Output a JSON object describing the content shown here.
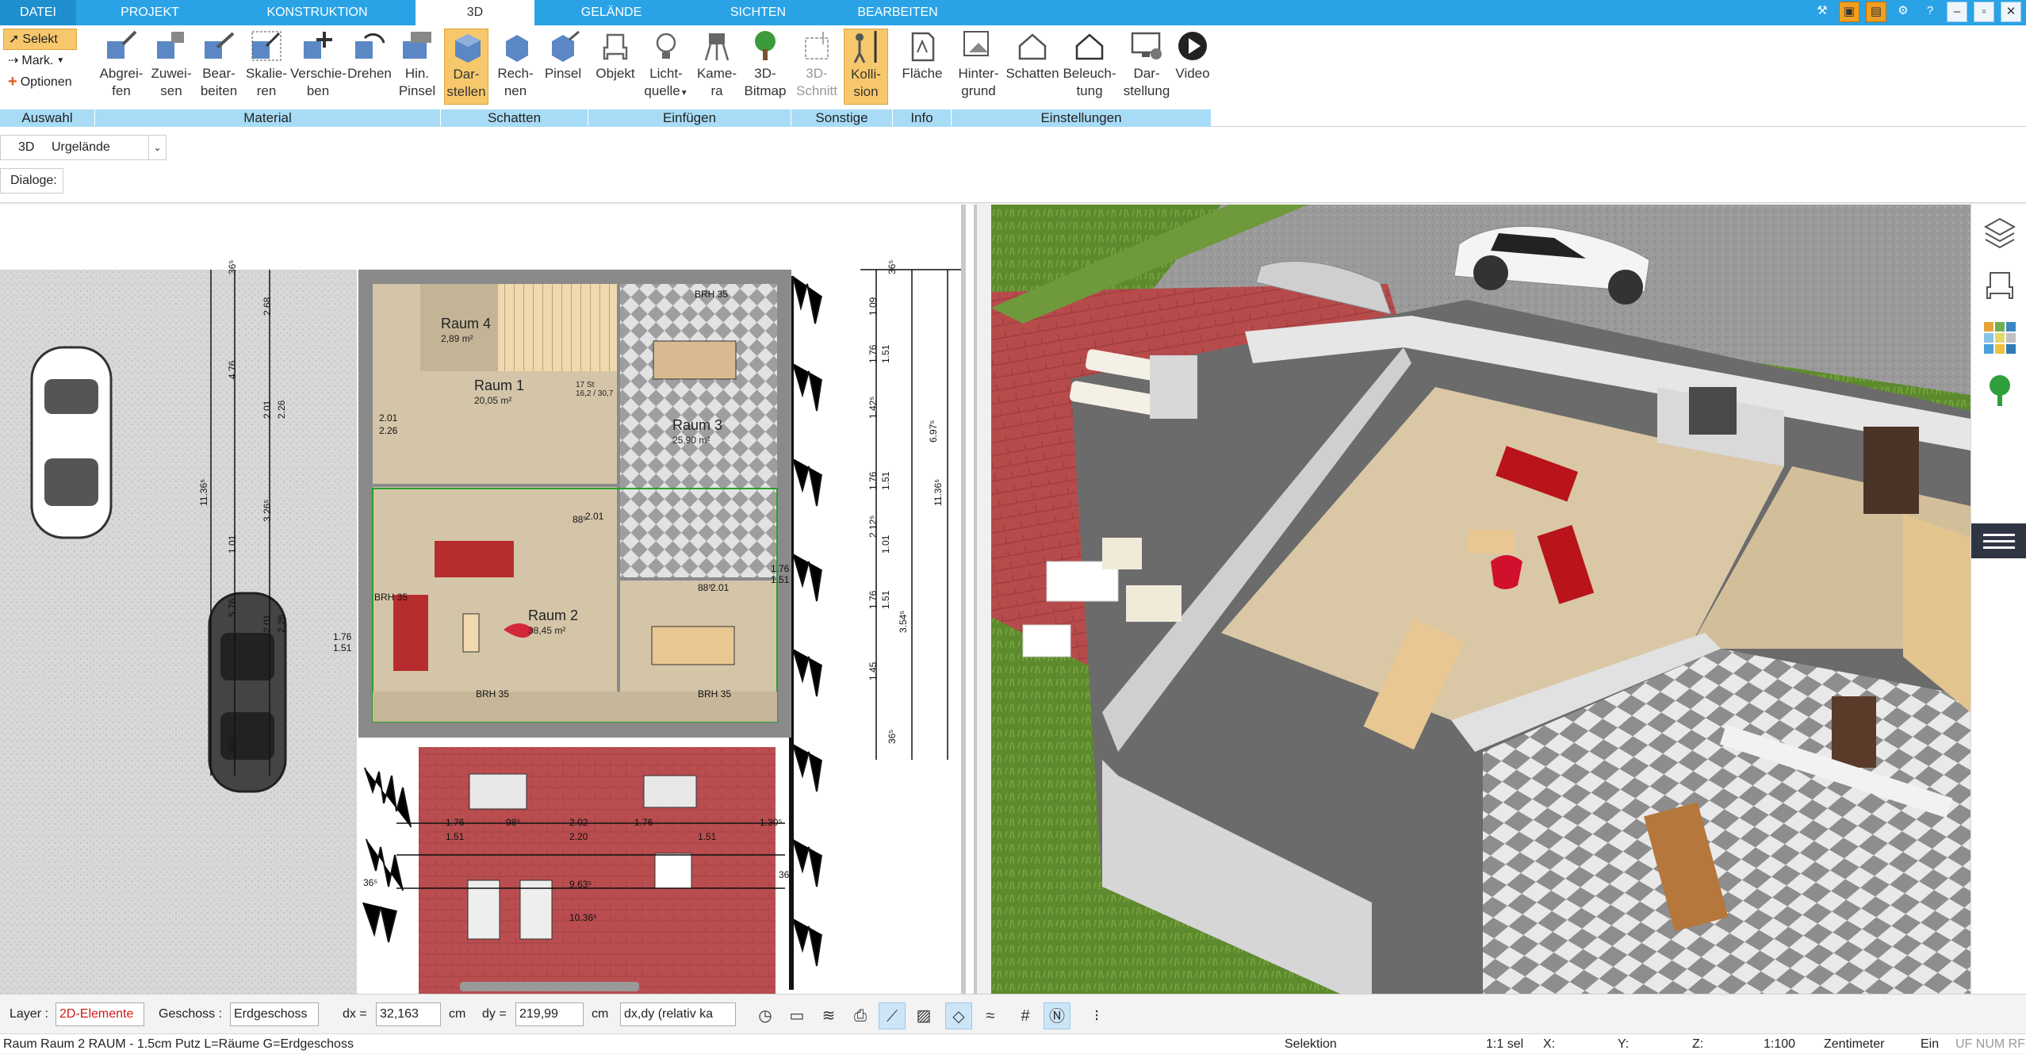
{
  "menu": {
    "tabs": [
      {
        "label": "DATEI"
      },
      {
        "label": "PROJEKT"
      },
      {
        "label": "KONSTRUKTION"
      },
      {
        "label": "3D"
      },
      {
        "label": "GELÄNDE"
      },
      {
        "label": "SICHTEN"
      },
      {
        "label": "BEARBEITEN"
      }
    ],
    "window_controls": [
      "tools-icon",
      "save-icon",
      "save-as-icon",
      "settings-icon",
      "help-icon",
      "minimize-icon",
      "maximize-icon",
      "close-icon"
    ]
  },
  "ribbon": {
    "auswahl": {
      "group": "Auswahl",
      "selekt": "Selekt",
      "mark": "Mark.",
      "optionen": "Optionen"
    },
    "material": {
      "group": "Material",
      "items": [
        {
          "label1": "Abgrei-",
          "label2": "fen"
        },
        {
          "label1": "Zuwei-",
          "label2": "sen"
        },
        {
          "label1": "Bear-",
          "label2": "beiten"
        },
        {
          "label1": "Skalie-",
          "label2": "ren"
        },
        {
          "label1": "Verschie-",
          "label2": "ben"
        },
        {
          "label1": "Drehen",
          "label2": ""
        },
        {
          "label1": "Hin.",
          "label2": "Pinsel"
        }
      ]
    },
    "schatten": {
      "group": "Schatten",
      "items": [
        {
          "label1": "Dar-",
          "label2": "stellen"
        },
        {
          "label1": "Rech-",
          "label2": "nen"
        },
        {
          "label1": "Pinsel",
          "label2": ""
        }
      ]
    },
    "einfuegen": {
      "group": "Einfügen",
      "items": [
        {
          "label1": "Objekt",
          "label2": ""
        },
        {
          "label1": "Licht-",
          "label2": "quelle"
        },
        {
          "label1": "Kame-",
          "label2": "ra"
        },
        {
          "label1": "3D-",
          "label2": "Bitmap"
        }
      ]
    },
    "sonstige": {
      "group": "Sonstige",
      "items": [
        {
          "label1": "3D-",
          "label2": "Schnitt"
        },
        {
          "label1": "Kolli-",
          "label2": "sion"
        }
      ]
    },
    "info": {
      "group": "Info",
      "items": [
        {
          "label1": "Fläche",
          "label2": ""
        }
      ]
    },
    "einstellungen": {
      "group": "Einstellungen",
      "items": [
        {
          "label1": "Hinter-",
          "label2": "grund"
        },
        {
          "label1": "Schatten",
          "label2": ""
        },
        {
          "label1": "Beleuch-",
          "label2": "tung"
        },
        {
          "label1": "Dar-",
          "label2": "stellung"
        },
        {
          "label1": "Video",
          "label2": ""
        }
      ]
    }
  },
  "subbar": {
    "mode": "3D",
    "terrain": "Urgelände",
    "dialoge_label": "Dialoge:"
  },
  "plan": {
    "rooms": [
      {
        "name": "Raum 4",
        "area": "2,89 m²"
      },
      {
        "name": "Raum 1",
        "area": "20,05 m²"
      },
      {
        "name": "Raum 3",
        "area": "25,90 m²"
      },
      {
        "name": "Raum 2",
        "area": "38,45 m²"
      }
    ],
    "stair_note": "17 St\n16,2 / 30,7",
    "dims_v1": [
      "36⁵",
      "2.68",
      "4.76",
      "2.01",
      "2.26",
      "11.36⁵",
      "3.26⁵",
      "1.01",
      "5.76",
      "2.01",
      "2.26",
      "36⁵"
    ],
    "dims_v2": [
      "36⁵",
      "1.09",
      "1.76",
      "1.51",
      "1.42⁵",
      "6.97⁵",
      "1.76",
      "1.51",
      "2.12⁵",
      "1.01",
      "1.76",
      "1.51",
      "3.54⁵",
      "1.45",
      "36⁵",
      "11.36⁵"
    ],
    "dims_h": [
      "1.76",
      "1.51",
      "98⁵",
      "2.02",
      "2.20",
      "1.76",
      "1.51",
      "1.30⁵",
      "9.63⁵",
      "10.36⁵",
      "36⁵",
      "36⁵"
    ],
    "misc": [
      "BRH 35",
      "BRH 35",
      "BRH 35",
      "BRH 35",
      "1.76",
      "1.51",
      "2.01",
      "2.26",
      "88⁵",
      "2.01",
      "88⁵",
      "2.01",
      "1.76",
      "1.51"
    ]
  },
  "bottom": {
    "layer_label": "Layer :",
    "layer_value": "2D-Elemente",
    "geschoss_label": "Geschoss :",
    "geschoss_value": "Erdgeschoss",
    "dx_label": "dx =",
    "dx_value": "32,163",
    "dx_unit": "cm",
    "dy_label": "dy =",
    "dy_value": "219,99",
    "dy_unit": "cm",
    "mode_value": "dx,dy (relativ ka",
    "tools": [
      "clock-icon",
      "monitor-icon",
      "layers-stack-icon",
      "print-icon",
      "measure-icon",
      "hatch-icon",
      "plane-icon",
      "stairs-icon",
      "grid-icon",
      "north-icon",
      "more-icon"
    ]
  },
  "status": {
    "left": "Raum Raum 2 RAUM - 1.5cm Putz L=Räume G=Erdgeschoss",
    "mode": "Selektion",
    "sel": "1:1 sel",
    "x": "X:",
    "y": "Y:",
    "z": "Z:",
    "scale": "1:100",
    "unit": "Zentimeter",
    "ein": "Ein",
    "flags": "UF NUM RF"
  },
  "sidebar": [
    "layers-icon",
    "furniture-icon",
    "materials-icon",
    "tree-icon",
    "menu-icon"
  ],
  "colors": {
    "accent": "#29a3e6",
    "ribbon_group": "#a8dcf6",
    "active_button": "#f7c86b",
    "terrace": "#b74b4b",
    "floor_wood": "#d9c7a6",
    "floor_stone": "#a7a199"
  }
}
